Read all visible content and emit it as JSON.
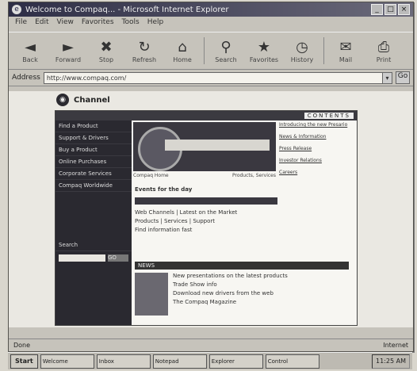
{
  "window": {
    "title": "Welcome to Compaq... - Microsoft Internet Explorer",
    "controls": [
      "_",
      "□",
      "×"
    ]
  },
  "menu": [
    "File",
    "Edit",
    "View",
    "Favorites",
    "Tools",
    "Help"
  ],
  "toolbar": [
    {
      "icon": "back-icon",
      "glyph": "◄",
      "label": "Back"
    },
    {
      "icon": "forward-icon",
      "glyph": "►",
      "label": "Forward"
    },
    {
      "icon": "stop-icon",
      "glyph": "✖",
      "label": "Stop"
    },
    {
      "icon": "refresh-icon",
      "glyph": "↻",
      "label": "Refresh"
    },
    {
      "icon": "home-icon",
      "glyph": "⌂",
      "label": "Home"
    },
    {
      "icon": "search-icon",
      "glyph": "⚲",
      "label": "Search"
    },
    {
      "icon": "favorites-icon",
      "glyph": "★",
      "label": "Favorites"
    },
    {
      "icon": "history-icon",
      "glyph": "◷",
      "label": "History"
    },
    {
      "icon": "mail-icon",
      "glyph": "✉",
      "label": "Mail"
    },
    {
      "icon": "print-icon",
      "glyph": "⎙",
      "label": "Print"
    }
  ],
  "address": {
    "label": "Address",
    "value": "http://www.compaq.com/",
    "go": "Go"
  },
  "channel": {
    "label": "Channel"
  },
  "page": {
    "top_label": "CONTENTS",
    "left_nav": [
      "Find a Product",
      "Support & Drivers",
      "Buy a Product",
      "Online Purchases",
      "Corporate Services",
      "Compaq Worldwide"
    ],
    "search_label": "Search",
    "search_go": "GO",
    "hero_caption_left": "Compaq Home",
    "hero_caption_right": "Products, Services",
    "right_nav": [
      "Introducing the new Presario",
      "News & Information",
      "Press Release",
      "Investor Relations",
      "Careers"
    ],
    "main_heading": "Events for the day",
    "main_lines": [
      "Web Channels | Latest on the Market",
      "Products | Services | Support",
      "Find information fast"
    ],
    "news_head": "NEWS",
    "news_lines": [
      "New presentations on the latest products",
      "Trade Show info",
      "Download new drivers from the web",
      "The Compaq Magazine"
    ]
  },
  "status": {
    "left": "Done",
    "right": "Internet"
  },
  "taskbar": {
    "start": "Start",
    "tasks": [
      "Welcome",
      "Inbox",
      "Notepad",
      "Explorer",
      "Control"
    ],
    "clock": "11:25 AM"
  }
}
